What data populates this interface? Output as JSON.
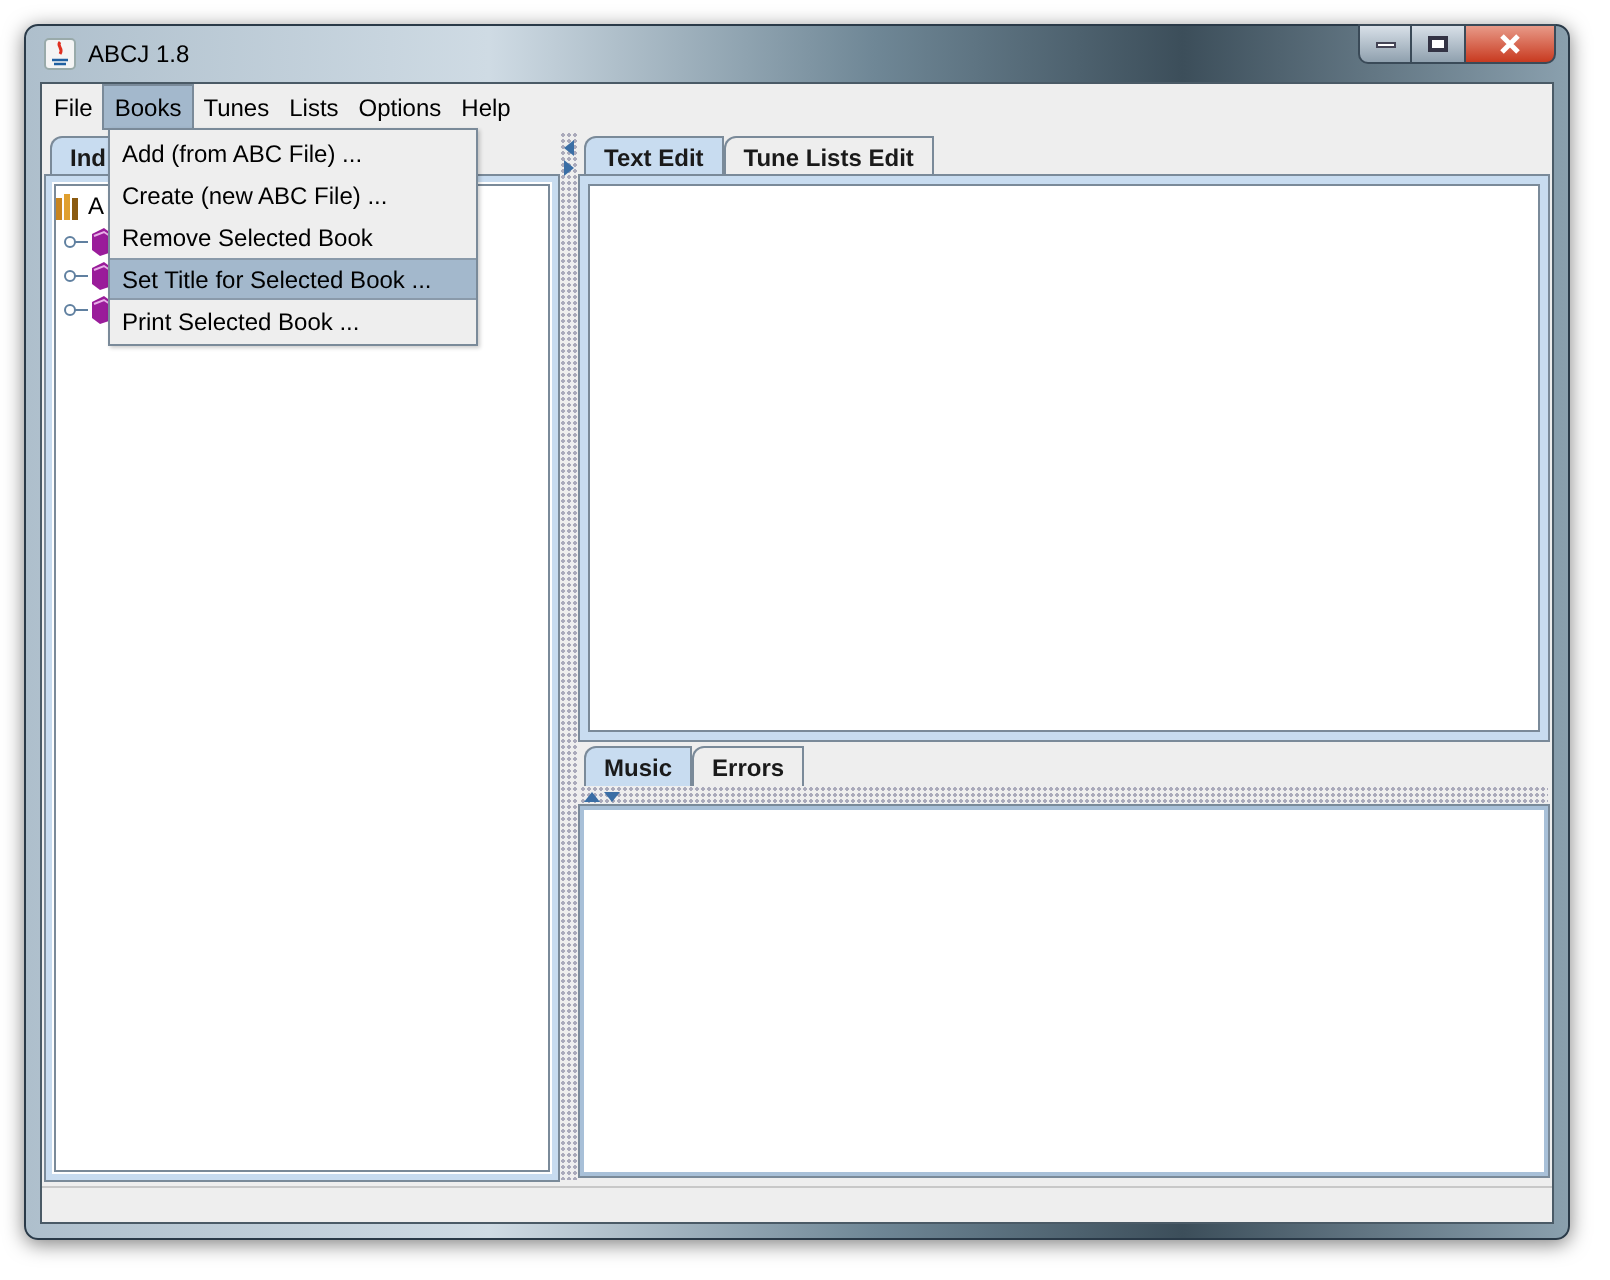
{
  "window": {
    "title": "ABCJ 1.8"
  },
  "menu_bar": [
    {
      "label": "File",
      "selected": false
    },
    {
      "label": "Books",
      "selected": true
    },
    {
      "label": "Tunes",
      "selected": false
    },
    {
      "label": "Lists",
      "selected": false
    },
    {
      "label": "Options",
      "selected": false
    },
    {
      "label": "Help",
      "selected": false
    }
  ],
  "open_menu": {
    "items": [
      {
        "label": "Add (from ABC File) ...",
        "selected": false
      },
      {
        "label": "Create (new ABC File) ...",
        "selected": false
      },
      {
        "label": "Remove Selected Book",
        "selected": false
      },
      {
        "label": "Set Title for Selected Book ...",
        "selected": true
      },
      {
        "label": "Print Selected Book ..."
      }
    ]
  },
  "left_panel": {
    "tabs": [
      {
        "label": "Ind",
        "selected": true
      }
    ],
    "tree": {
      "label": "A",
      "kind": "library",
      "children": [
        {
          "kind": "book"
        },
        {
          "kind": "book"
        },
        {
          "kind": "book"
        }
      ]
    }
  },
  "editor_tabs": [
    {
      "label": "Text Edit",
      "selected": true
    },
    {
      "label": "Tune Lists Edit",
      "selected": false
    }
  ],
  "output_tabs": [
    {
      "label": "Music",
      "selected": true
    },
    {
      "label": "Errors",
      "selected": false
    }
  ]
}
